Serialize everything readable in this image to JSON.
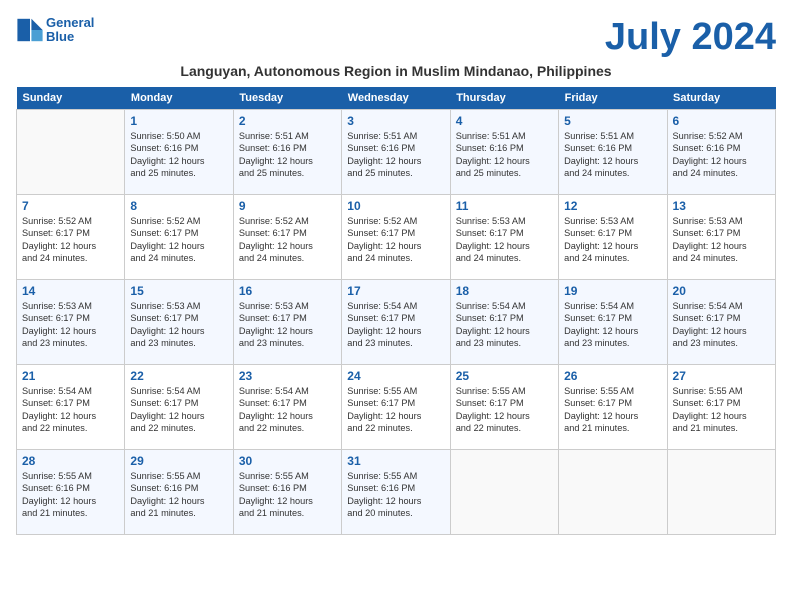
{
  "header": {
    "logo_line1": "General",
    "logo_line2": "Blue",
    "month_year": "July 2024",
    "location": "Languyan, Autonomous Region in Muslim Mindanao, Philippines"
  },
  "weekdays": [
    "Sunday",
    "Monday",
    "Tuesday",
    "Wednesday",
    "Thursday",
    "Friday",
    "Saturday"
  ],
  "weeks": [
    [
      {
        "day": "",
        "info": ""
      },
      {
        "day": "1",
        "info": "Sunrise: 5:50 AM\nSunset: 6:16 PM\nDaylight: 12 hours\nand 25 minutes."
      },
      {
        "day": "2",
        "info": "Sunrise: 5:51 AM\nSunset: 6:16 PM\nDaylight: 12 hours\nand 25 minutes."
      },
      {
        "day": "3",
        "info": "Sunrise: 5:51 AM\nSunset: 6:16 PM\nDaylight: 12 hours\nand 25 minutes."
      },
      {
        "day": "4",
        "info": "Sunrise: 5:51 AM\nSunset: 6:16 PM\nDaylight: 12 hours\nand 25 minutes."
      },
      {
        "day": "5",
        "info": "Sunrise: 5:51 AM\nSunset: 6:16 PM\nDaylight: 12 hours\nand 24 minutes."
      },
      {
        "day": "6",
        "info": "Sunrise: 5:52 AM\nSunset: 6:16 PM\nDaylight: 12 hours\nand 24 minutes."
      }
    ],
    [
      {
        "day": "7",
        "info": "Sunrise: 5:52 AM\nSunset: 6:17 PM\nDaylight: 12 hours\nand 24 minutes."
      },
      {
        "day": "8",
        "info": "Sunrise: 5:52 AM\nSunset: 6:17 PM\nDaylight: 12 hours\nand 24 minutes."
      },
      {
        "day": "9",
        "info": "Sunrise: 5:52 AM\nSunset: 6:17 PM\nDaylight: 12 hours\nand 24 minutes."
      },
      {
        "day": "10",
        "info": "Sunrise: 5:52 AM\nSunset: 6:17 PM\nDaylight: 12 hours\nand 24 minutes."
      },
      {
        "day": "11",
        "info": "Sunrise: 5:53 AM\nSunset: 6:17 PM\nDaylight: 12 hours\nand 24 minutes."
      },
      {
        "day": "12",
        "info": "Sunrise: 5:53 AM\nSunset: 6:17 PM\nDaylight: 12 hours\nand 24 minutes."
      },
      {
        "day": "13",
        "info": "Sunrise: 5:53 AM\nSunset: 6:17 PM\nDaylight: 12 hours\nand 24 minutes."
      }
    ],
    [
      {
        "day": "14",
        "info": "Sunrise: 5:53 AM\nSunset: 6:17 PM\nDaylight: 12 hours\nand 23 minutes."
      },
      {
        "day": "15",
        "info": "Sunrise: 5:53 AM\nSunset: 6:17 PM\nDaylight: 12 hours\nand 23 minutes."
      },
      {
        "day": "16",
        "info": "Sunrise: 5:53 AM\nSunset: 6:17 PM\nDaylight: 12 hours\nand 23 minutes."
      },
      {
        "day": "17",
        "info": "Sunrise: 5:54 AM\nSunset: 6:17 PM\nDaylight: 12 hours\nand 23 minutes."
      },
      {
        "day": "18",
        "info": "Sunrise: 5:54 AM\nSunset: 6:17 PM\nDaylight: 12 hours\nand 23 minutes."
      },
      {
        "day": "19",
        "info": "Sunrise: 5:54 AM\nSunset: 6:17 PM\nDaylight: 12 hours\nand 23 minutes."
      },
      {
        "day": "20",
        "info": "Sunrise: 5:54 AM\nSunset: 6:17 PM\nDaylight: 12 hours\nand 23 minutes."
      }
    ],
    [
      {
        "day": "21",
        "info": "Sunrise: 5:54 AM\nSunset: 6:17 PM\nDaylight: 12 hours\nand 22 minutes."
      },
      {
        "day": "22",
        "info": "Sunrise: 5:54 AM\nSunset: 6:17 PM\nDaylight: 12 hours\nand 22 minutes."
      },
      {
        "day": "23",
        "info": "Sunrise: 5:54 AM\nSunset: 6:17 PM\nDaylight: 12 hours\nand 22 minutes."
      },
      {
        "day": "24",
        "info": "Sunrise: 5:55 AM\nSunset: 6:17 PM\nDaylight: 12 hours\nand 22 minutes."
      },
      {
        "day": "25",
        "info": "Sunrise: 5:55 AM\nSunset: 6:17 PM\nDaylight: 12 hours\nand 22 minutes."
      },
      {
        "day": "26",
        "info": "Sunrise: 5:55 AM\nSunset: 6:17 PM\nDaylight: 12 hours\nand 21 minutes."
      },
      {
        "day": "27",
        "info": "Sunrise: 5:55 AM\nSunset: 6:17 PM\nDaylight: 12 hours\nand 21 minutes."
      }
    ],
    [
      {
        "day": "28",
        "info": "Sunrise: 5:55 AM\nSunset: 6:16 PM\nDaylight: 12 hours\nand 21 minutes."
      },
      {
        "day": "29",
        "info": "Sunrise: 5:55 AM\nSunset: 6:16 PM\nDaylight: 12 hours\nand 21 minutes."
      },
      {
        "day": "30",
        "info": "Sunrise: 5:55 AM\nSunset: 6:16 PM\nDaylight: 12 hours\nand 21 minutes."
      },
      {
        "day": "31",
        "info": "Sunrise: 5:55 AM\nSunset: 6:16 PM\nDaylight: 12 hours\nand 20 minutes."
      },
      {
        "day": "",
        "info": ""
      },
      {
        "day": "",
        "info": ""
      },
      {
        "day": "",
        "info": ""
      }
    ]
  ]
}
